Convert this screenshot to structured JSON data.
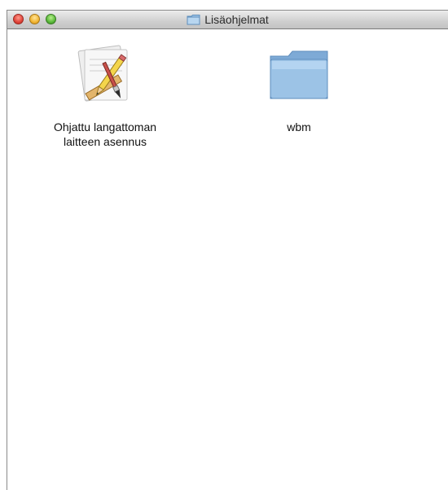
{
  "window": {
    "title": "Lisäohjelmat"
  },
  "items": [
    {
      "label": "Ohjattu langattoman\nlaitteen asennus",
      "icon": "app-document-icon"
    },
    {
      "label": "wbm",
      "icon": "folder-icon"
    }
  ],
  "colors": {
    "folder": "#8fb6d9",
    "close": "#e0443a",
    "minimize": "#f1b533",
    "maximize": "#59b83a"
  }
}
